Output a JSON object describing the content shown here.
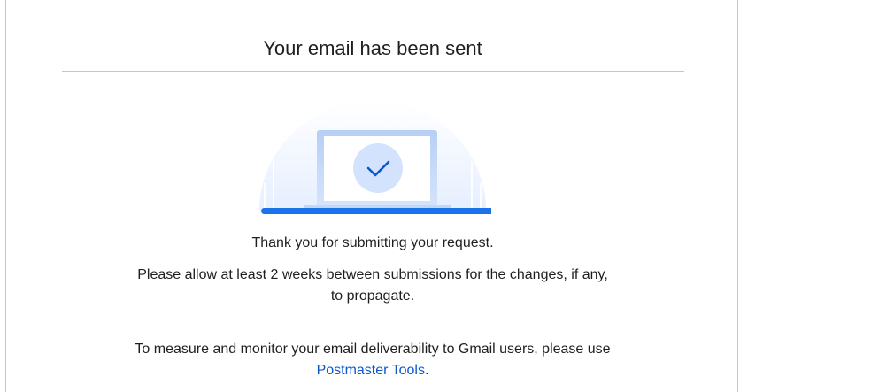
{
  "dialog": {
    "title": "Your email has been sent",
    "thank_you": "Thank you for submitting your request.",
    "allow_message": "Please allow at least 2 weeks between submissions for the changes, if any, to propagate.",
    "monitor_prefix": "To measure and monitor your email deliverability to Gmail users, please use ",
    "monitor_link": "Postmaster Tools",
    "monitor_suffix": "."
  },
  "icons": {
    "illustration": "laptop-checkmark-illustration",
    "check": "checkmark-icon"
  },
  "colors": {
    "accent": "#1a73e8",
    "link": "#0b57d0",
    "check_circle": "#d3e3fd",
    "check_mark": "#0b57d0"
  }
}
